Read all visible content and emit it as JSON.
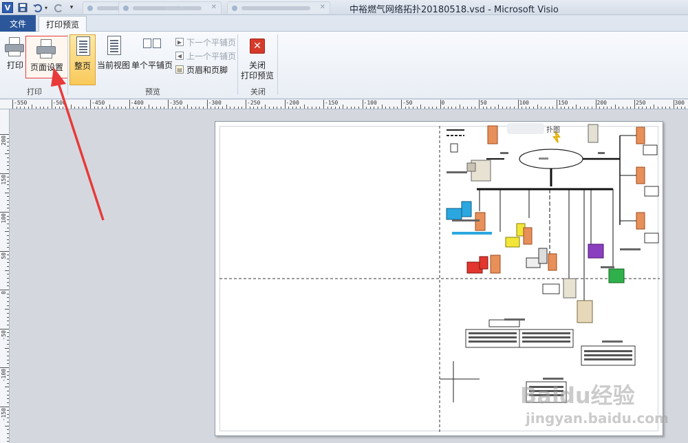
{
  "titlebar": {
    "title": "中裕燃气网络拓扑20180518.vsd  -  Microsoft Visio",
    "visio_letter": "V"
  },
  "tabs": {
    "file": "文件",
    "print_preview": "打印预览"
  },
  "ribbon": {
    "print_group": {
      "label": "打印",
      "print": "打印",
      "page_setup": "页面设置"
    },
    "preview_group": {
      "label": "预览",
      "whole_page": "整页",
      "current_view": "当前视图",
      "single_tile": "单个平铺页",
      "next_tile": "下一个平铺页",
      "prev_tile": "上一个平铺页",
      "header_footer": "页眉和页脚"
    },
    "close_group": {
      "label": "关闭",
      "close_line1": "关闭",
      "close_line2": "打印预览"
    }
  },
  "ruler_h_labels": [
    "-550",
    "-500",
    "-450",
    "-400",
    "-350",
    "-300",
    "-250",
    "-200",
    "-150",
    "-100",
    "-50",
    "0",
    "50",
    "100",
    "150",
    "200",
    "250",
    "300"
  ],
  "ruler_v_labels": [
    "200",
    "150",
    "100",
    "50",
    "0",
    "-50",
    "-100",
    "-150"
  ],
  "diagram": {
    "title_fragment": "扑图"
  },
  "watermark": {
    "brand": "Baidu经验",
    "url": "jingyan.baidu.com"
  },
  "colors": {
    "file_tab": "#2b579a",
    "annotation_arrow": "#e83a3a",
    "active_button": "#f9c95a"
  }
}
